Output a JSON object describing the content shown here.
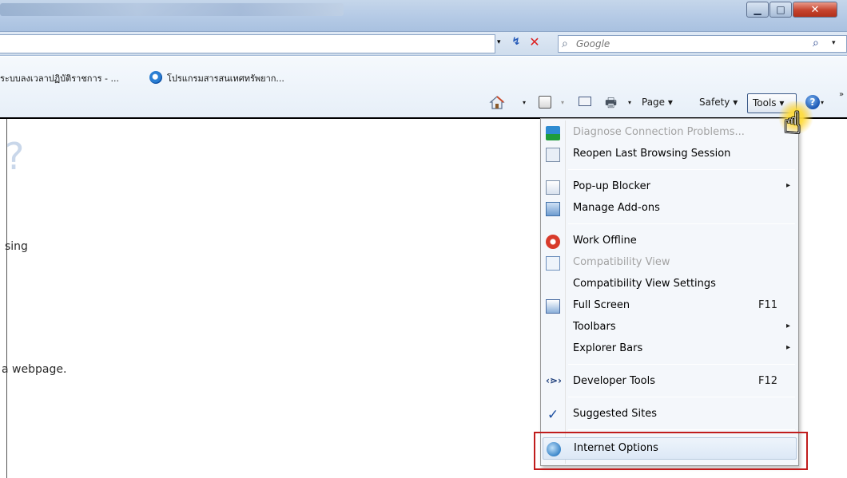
{
  "window": {
    "minimize_glyph": "▁",
    "maximize_glyph": "□",
    "close_glyph": "✕"
  },
  "address_bar": {
    "dropdown_glyph": "▾",
    "refresh_glyph": "↯",
    "stop_glyph": "✕"
  },
  "search": {
    "placeholder": "Google",
    "engine_icon": "search-icon",
    "go_glyph": "⌕",
    "dropdown_glyph": "▾"
  },
  "favorites": [
    {
      "label": "ระบบลงเวลาปฏิบัติราชการ - ...",
      "icon": "none"
    },
    {
      "label": "โปรแกรมสารสนเทศทรัพยาก...",
      "icon": "ie-icon"
    }
  ],
  "command_bar": {
    "page_label": "Page ▾",
    "safety_label": "Safety ▾",
    "tools_label": "Tools ▾",
    "dd_glyph": "▾",
    "help_glyph": "?",
    "chevron_glyph": "»",
    "print_glyph": "🖶"
  },
  "content": {
    "qmark": "?",
    "text_1": "sing",
    "text_2": "a webpage."
  },
  "tools_menu": {
    "items": [
      {
        "label": "Diagnose Connection Problems...",
        "enabled": false,
        "icon": "diagnose-icon"
      },
      {
        "label": "Reopen Last Browsing Session",
        "enabled": true,
        "icon": "reopen-session-icon"
      },
      {
        "label": "Pop-up Blocker",
        "enabled": true,
        "submenu": "▸",
        "icon": "popup-blocker-icon"
      },
      {
        "label": "Manage Add-ons",
        "enabled": true,
        "icon": "addons-icon"
      },
      {
        "label": "Work Offline",
        "enabled": true,
        "icon": "offline-icon"
      },
      {
        "label": "Compatibility View",
        "enabled": false,
        "icon": "compatibility-icon"
      },
      {
        "label": "Compatibility View Settings",
        "enabled": true
      },
      {
        "label": "Full Screen",
        "shortcut": "F11",
        "enabled": true,
        "icon": "fullscreen-icon"
      },
      {
        "label": "Toolbars",
        "submenu": "▸",
        "enabled": true
      },
      {
        "label": "Explorer Bars",
        "submenu": "▸",
        "enabled": true
      },
      {
        "label": "Developer Tools",
        "shortcut": "F12",
        "enabled": true,
        "icon": "developer-tools-icon",
        "icon_glyph": "‹⋗›"
      },
      {
        "label": "Suggested Sites",
        "enabled": true,
        "checked": true,
        "icon_glyph": "✓"
      },
      {
        "label": "Internet Options",
        "enabled": true,
        "highlighted": true,
        "icon": "internet-options-icon"
      }
    ]
  },
  "colors": {
    "highlight_border": "#c01c1c",
    "disabled_text": "#a3a3a3",
    "menu_background": "#f4f7fb"
  },
  "cursor": {
    "glyph": "☝"
  }
}
